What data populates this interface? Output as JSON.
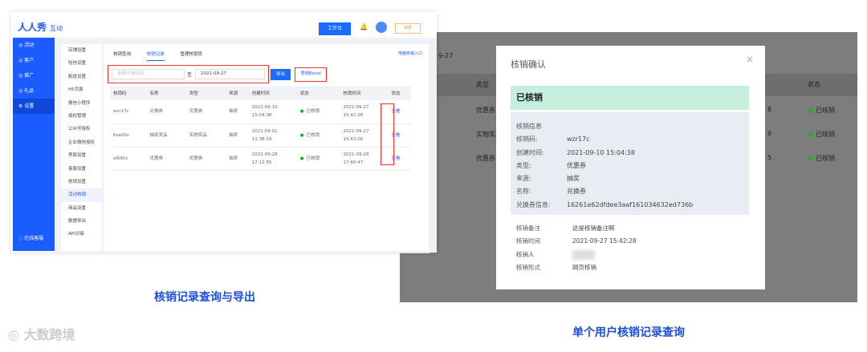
{
  "left_app": {
    "logo": "人人秀",
    "logo_sub": "互动",
    "workbench": "工作台",
    "renew": "续费",
    "sidebar": [
      "活动",
      "客户",
      "推广",
      "礼品",
      "设置"
    ],
    "online_service": "在线客服",
    "submenu": [
      "店铺设置",
      "短信设置",
      "配送设置",
      "H5页面",
      "微信小程序",
      "授权管理",
      "公众号授权",
      "企业微信授权",
      "界面设置",
      "客服设置",
      "核销设置",
      "活动核销",
      "商品设置",
      "数据导出",
      "API对接"
    ],
    "tabs": [
      "核销查询",
      "核销记录",
      "管理核销员"
    ],
    "pc_link": "电脑核销入口",
    "start_placeholder": "选择开始时间",
    "to": "至",
    "end_date": "2021-09-27",
    "export": "导出",
    "export_excel": "导出Excel",
    "headers": [
      "核销码",
      "名称",
      "类型",
      "来源",
      "创建时间",
      "状态",
      "核销时间",
      "状态"
    ],
    "rows": [
      [
        "wzr17c",
        "兑换券",
        "优惠券",
        "抽奖",
        "2021-09-10 15:04:38",
        "已核销",
        "2021-09-27 15:42:28",
        "查看"
      ],
      [
        "6sa00v",
        "抽奖奖品",
        "实物奖品",
        "抽奖",
        "2021-09-01 11:38:19",
        "已核销",
        "2021-09-27 15:43:00",
        "查看"
      ],
      [
        "e6l9hc",
        "优惠券",
        "优惠券",
        "抽奖",
        "2021-09-28 17:12:55",
        "已核销",
        "2021-09-28 17:40:47",
        "查看"
      ]
    ]
  },
  "right_app": {
    "bg_date": "9-27",
    "bg_type": "类型",
    "bg_status": "状态",
    "bg_rows": [
      "优惠券",
      "实物奖品",
      "优惠券"
    ],
    "bg_tail": [
      "8",
      "9",
      "5"
    ],
    "bg_state": "已核销",
    "modal_title": "核销确认",
    "close": "×",
    "status": "已核销",
    "info_title": "核销信息",
    "info": [
      [
        "核销码:",
        "wzr17c"
      ],
      [
        "创建时间:",
        "2021-09-10 15:04:38"
      ],
      [
        "类型:",
        "优惠券"
      ],
      [
        "来源:",
        "抽奖"
      ],
      [
        "名称:",
        "兑换券"
      ],
      [
        "兑换券信息:",
        "16261e62dfdee3aaf161034632ed736b"
      ]
    ],
    "extra": [
      [
        "核销备注",
        "这是核销备注啊"
      ],
      [
        "核销时间",
        "2021-09-27 15:42:28"
      ],
      [
        "核销人",
        ""
      ],
      [
        "核销形式",
        "网页核销"
      ]
    ]
  },
  "captions": {
    "left": "核销记录查询与导出",
    "right": "单个用户核销记录查询"
  },
  "watermark": "大数跨境"
}
